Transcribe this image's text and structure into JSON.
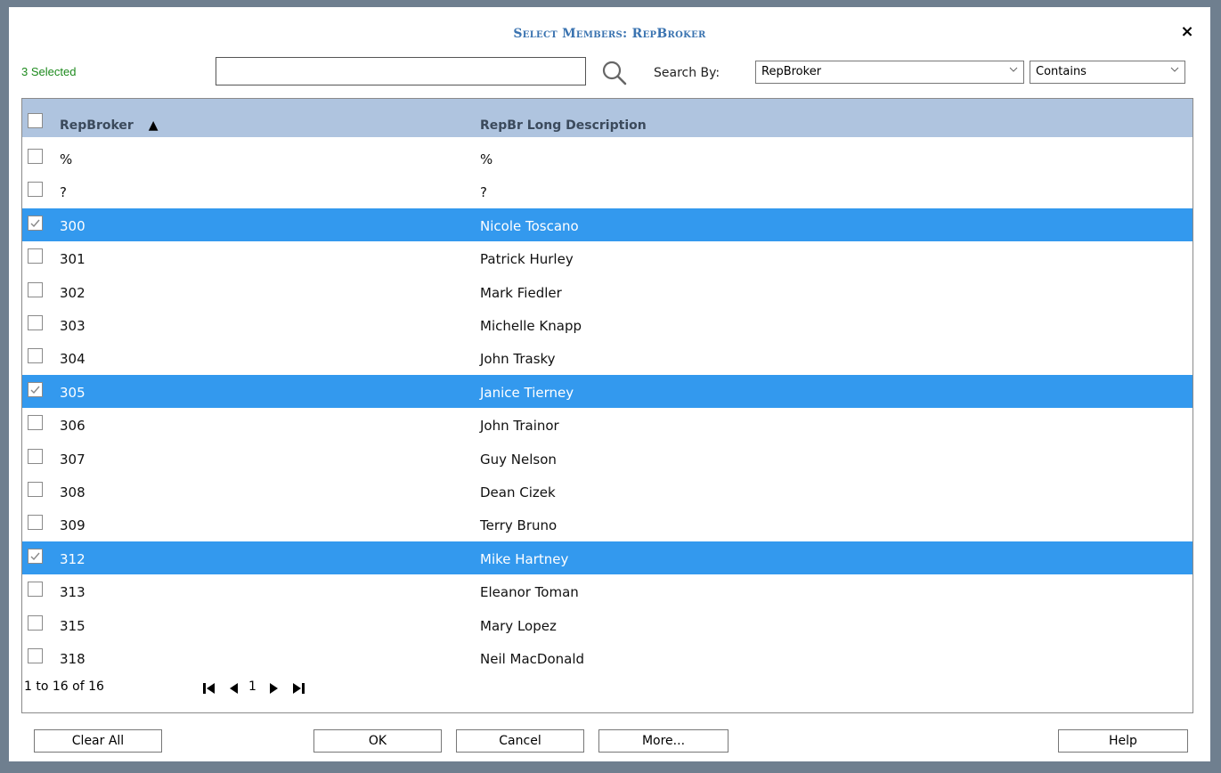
{
  "dialog": {
    "title": "Select Members: RepBroker",
    "close_label": "×",
    "selected_count": "3 Selected"
  },
  "search": {
    "value": "",
    "placeholder": "",
    "search_by_label": "Search By:",
    "field_value": "RepBroker",
    "operator_value": "Contains"
  },
  "grid": {
    "columns": [
      "RepBroker",
      "RepBr Long Description"
    ],
    "sort_indicator": "▲",
    "rows": [
      {
        "code": "%",
        "desc": "%",
        "checked": false
      },
      {
        "code": "?",
        "desc": "?",
        "checked": false
      },
      {
        "code": "300",
        "desc": "Nicole Toscano",
        "checked": true
      },
      {
        "code": "301",
        "desc": "Patrick Hurley",
        "checked": false
      },
      {
        "code": "302",
        "desc": "Mark Fiedler",
        "checked": false
      },
      {
        "code": "303",
        "desc": "Michelle Knapp",
        "checked": false
      },
      {
        "code": "304",
        "desc": "John Trasky",
        "checked": false
      },
      {
        "code": "305",
        "desc": "Janice Tierney",
        "checked": true
      },
      {
        "code": "306",
        "desc": "John Trainor",
        "checked": false
      },
      {
        "code": "307",
        "desc": "Guy Nelson",
        "checked": false
      },
      {
        "code": "308",
        "desc": "Dean Cizek",
        "checked": false
      },
      {
        "code": "309",
        "desc": "Terry Bruno",
        "checked": false
      },
      {
        "code": "312",
        "desc": "Mike Hartney",
        "checked": true
      },
      {
        "code": "313",
        "desc": "Eleanor Toman",
        "checked": false
      },
      {
        "code": "315",
        "desc": "Mary Lopez",
        "checked": false
      },
      {
        "code": "318",
        "desc": "Neil MacDonald",
        "checked": false
      }
    ]
  },
  "pager": {
    "summary": "1 to 16 of 16",
    "page": "1"
  },
  "buttons": {
    "clear_all": "Clear All",
    "ok": "OK",
    "cancel": "Cancel",
    "more": "More...",
    "help": "Help"
  },
  "colors": {
    "title": "#3a73b0",
    "selected_row": "#3399ee",
    "header_bg": "#afc4df",
    "selected_count": "#1d8a1d",
    "backdrop": "#6f7f8f"
  }
}
